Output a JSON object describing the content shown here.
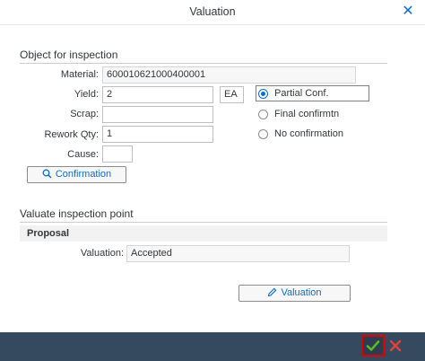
{
  "dialog": {
    "title": "Valuation"
  },
  "object_section": {
    "title": "Object for inspection",
    "material_label": "Material:",
    "material_value": "600010621000400001",
    "yield_label": "Yield:",
    "yield_value": "2",
    "yield_unit": "EA",
    "scrap_label": "Scrap:",
    "scrap_value": "",
    "rework_label": "Rework Qty:",
    "rework_value": "1",
    "cause_label": "Cause:",
    "cause_value": "",
    "confirmation_button": "Confirmation",
    "confirmation_options": [
      {
        "label": "Partial Conf.",
        "selected": true
      },
      {
        "label": "Final confirmtn",
        "selected": false
      },
      {
        "label": "No confirmation",
        "selected": false
      }
    ]
  },
  "valuate_section": {
    "title": "Valuate inspection point",
    "proposal_title": "Proposal",
    "valuation_label": "Valuation:",
    "valuation_value": "Accepted",
    "valuation_button": "Valuation"
  },
  "colors": {
    "accent": "#0a6ed1",
    "footer": "#354a5f",
    "ok_highlight": "#e00000",
    "ok_check": "#5ab82a",
    "cancel": "#e3413b"
  }
}
